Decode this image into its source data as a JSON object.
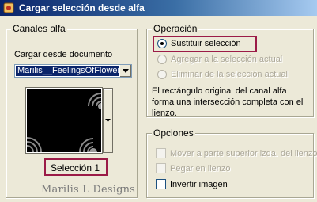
{
  "window": {
    "title": "Cargar selección desde alfa"
  },
  "left": {
    "group_title": "Canales alfa",
    "load_from_label": "Cargar desde documento",
    "document_select": {
      "value": "Marilis__FeelingsOfFlowers"
    },
    "channel_label": "Selección 1",
    "watermark": "Marilis L Designs"
  },
  "operation": {
    "group_title": "Operación",
    "options": [
      {
        "label": "Sustituir selección",
        "checked": true,
        "enabled": true
      },
      {
        "label": "Agregar a la selección actual",
        "checked": false,
        "enabled": false
      },
      {
        "label": "Eliminar de la selección actual",
        "checked": false,
        "enabled": false
      }
    ],
    "description": "El rectángulo original del canal alfa forma una intersección completa con el lienzo."
  },
  "options": {
    "group_title": "Opciones",
    "items": [
      {
        "label": "Mover a parte superior izda. del lienzo",
        "checked": false,
        "enabled": false
      },
      {
        "label": "Pegar en lienzo",
        "checked": false,
        "enabled": false
      },
      {
        "label": "Invertir imagen",
        "checked": false,
        "enabled": true
      }
    ]
  },
  "colors": {
    "titlebar_start": "#0a246a",
    "titlebar_end": "#a6caf0",
    "dialog_bg": "#ece9d8",
    "highlight": "#9b1b47",
    "select_highlight": "#0a246a"
  },
  "icons": {
    "app": "app-logo-icon",
    "dropdown": "chevron-down-icon",
    "preview_dropdown": "triangle-down-icon"
  }
}
